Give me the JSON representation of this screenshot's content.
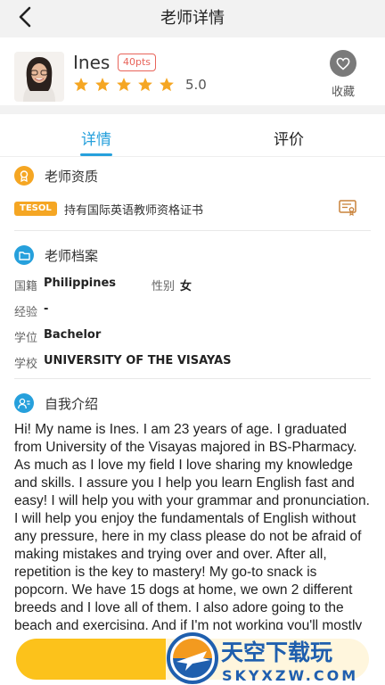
{
  "nav": {
    "title": "老师详情"
  },
  "teacher": {
    "name": "Ines",
    "points_badge": "40pts",
    "rating": 5,
    "rating_label": "5.0",
    "favorite_label": "收藏"
  },
  "tabs": [
    {
      "label": "详情",
      "active": true
    },
    {
      "label": "评价",
      "active": false
    }
  ],
  "qualification": {
    "title": "老师资质",
    "badge": "TESOL",
    "text": "持有国际英语教师资格证书"
  },
  "profile": {
    "title": "老师档案",
    "fields": [
      {
        "label": "国籍",
        "value": "Philippines"
      },
      {
        "label": "性别",
        "value": "女"
      },
      {
        "label": "经验",
        "value": "-"
      },
      {
        "label": "学位",
        "value": "Bachelor"
      },
      {
        "label": "学校",
        "value": "UNIVERSITY OF THE VISAYAS"
      }
    ]
  },
  "intro": {
    "title": "自我介绍",
    "text": "Hi! My name is Ines. I am 23 years of age. I graduated from University of the Visayas majored in BS-Pharmacy. As much as I love my field I love sharing my knowledge and skills. I assure you I help you learn English fast and easy! I will help you with your grammar and pronunciation. I will help you enjoy the fundamentals of English without any pressure, here in my class please do not be afraid of making mistakes and trying over and over. After all, repetition is the key to mastery! My go-to snack is popcorn. We have 15 dogs at home, we own 2 different breeds and I love all of them. I also adore going to the beach and exercising. And if I'm not working you'll mostly find me reviewing/studying or singing and"
  },
  "watermark": {
    "text_cn": "天空下载玩",
    "text_en": "SKYXZW.COM"
  },
  "colors": {
    "accent": "#26a0dc",
    "star": "#f5a623",
    "badge": "#e8645a",
    "button": "#fcc21b"
  }
}
